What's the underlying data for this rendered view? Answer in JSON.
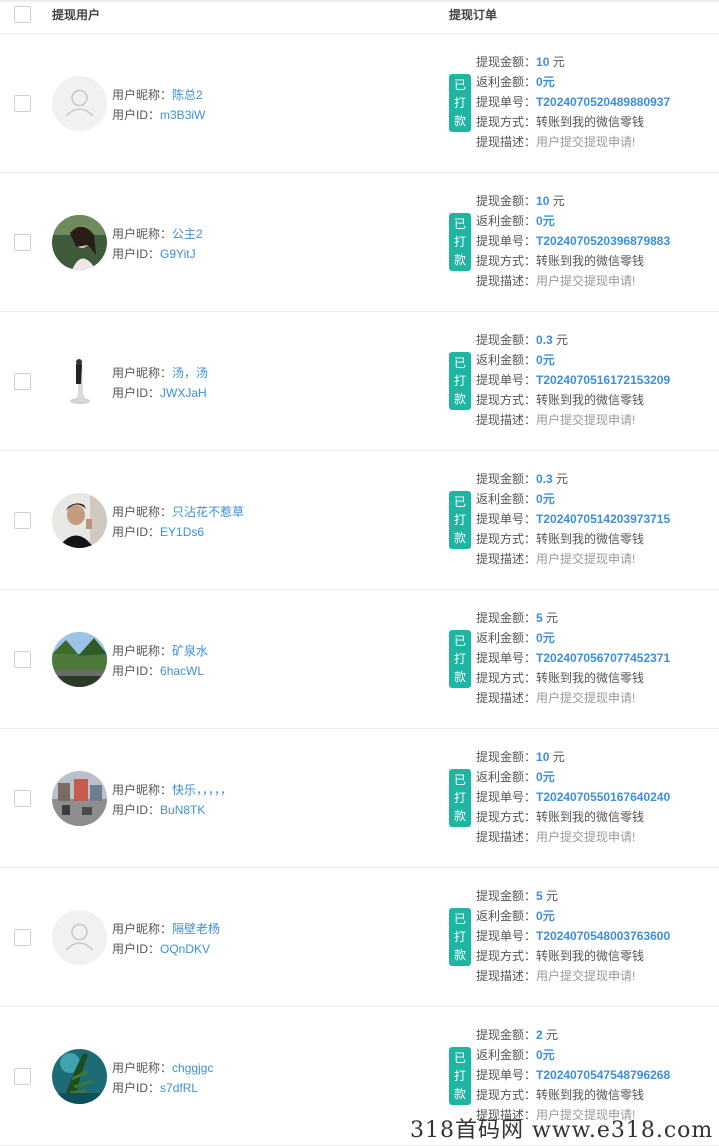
{
  "header": {
    "col_user": "提现用户",
    "col_order": "提现订单"
  },
  "labels": {
    "nickname": "用户昵称：",
    "user_id": "用户ID：",
    "amount": "提现金额：",
    "rebate": "返利金额：",
    "order_no": "提现单号：",
    "method": "提现方式：",
    "desc": "提现描述：",
    "yuan": "元"
  },
  "badge": [
    "已",
    "打",
    "款"
  ],
  "rows": [
    {
      "nickname": "陈总2",
      "user_id": "m3B3iW",
      "avatar": "default-avatar",
      "amount": "10",
      "rebate": "0元",
      "order_no": "T2024070520489880937",
      "method": "转账到我的微信零钱",
      "desc": "用户提交提现申请!"
    },
    {
      "nickname": "公主2",
      "user_id": "G9YitJ",
      "avatar": "photo-woman",
      "amount": "10",
      "rebate": "0元",
      "order_no": "T2024070520396879883",
      "method": "转账到我的微信零钱",
      "desc": "用户提交提现申请!"
    },
    {
      "nickname": "汤，汤",
      "user_id": "JWXJaH",
      "avatar": "photo-figure",
      "amount": "0.3",
      "rebate": "0元",
      "order_no": "T2024070516172153209",
      "method": "转账到我的微信零钱",
      "desc": "用户提交提现申请!"
    },
    {
      "nickname": "只沾花不惹草",
      "user_id": "EY1Ds6",
      "avatar": "photo-man",
      "amount": "0.3",
      "rebate": "0元",
      "order_no": "T2024070514203973715",
      "method": "转账到我的微信零钱",
      "desc": "用户提交提现申请!"
    },
    {
      "nickname": "矿泉水",
      "user_id": "6hacWL",
      "avatar": "photo-landscape",
      "amount": "5",
      "rebate": "0元",
      "order_no": "T2024070567077452371",
      "method": "转账到我的微信零钱",
      "desc": "用户提交提现申请!"
    },
    {
      "nickname": "快乐，，，，，",
      "user_id": "BuN8TK",
      "avatar": "photo-street",
      "amount": "10",
      "rebate": "0元",
      "order_no": "T2024070550167640240",
      "method": "转账到我的微信零钱",
      "desc": "用户提交提现申请!"
    },
    {
      "nickname": "隔壁老杨",
      "user_id": "OQnDKV",
      "avatar": "default-avatar",
      "amount": "5",
      "rebate": "0元",
      "order_no": "T2024070548003763600",
      "method": "转账到我的微信零钱",
      "desc": "用户提交提现申请!"
    },
    {
      "nickname": "chggjgc",
      "user_id": "s7dfRL",
      "avatar": "photo-nature",
      "amount": "2",
      "rebate": "0元",
      "order_no": "T2024070547548796268",
      "method": "转账到我的微信零钱",
      "desc": "用户提交提现申请!"
    }
  ],
  "watermark": "318首码网   www.e318.com",
  "colors": {
    "accent": "#3d8fd9",
    "badge": "#1fb5a3"
  }
}
